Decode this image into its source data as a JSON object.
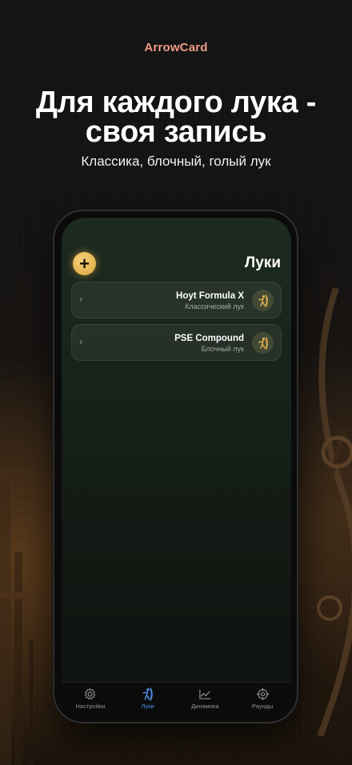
{
  "brand": "ArrowCard",
  "headline": {
    "line1": "Для каждого лука -",
    "line2": "своя запись"
  },
  "subheadline": "Классика, блочный, голый лук",
  "colors": {
    "brand": "#f19a86",
    "accent_gold": "#e8b552",
    "active_tab": "#4f8fe8"
  },
  "app": {
    "title": "Луки",
    "add_button_label": "+",
    "bows": [
      {
        "name": "Hoyt Formula X",
        "type": "Классический лук",
        "icon": "archer-icon"
      },
      {
        "name": "PSE Compound",
        "type": "Блочный лук",
        "icon": "archer-icon"
      }
    ],
    "tabs": [
      {
        "label": "Настройки",
        "icon": "gear-icon",
        "active": false
      },
      {
        "label": "Луки",
        "icon": "archer-icon",
        "active": true
      },
      {
        "label": "Динамика",
        "icon": "chart-icon",
        "active": false
      },
      {
        "label": "Раунды",
        "icon": "target-icon",
        "active": false
      }
    ]
  }
}
